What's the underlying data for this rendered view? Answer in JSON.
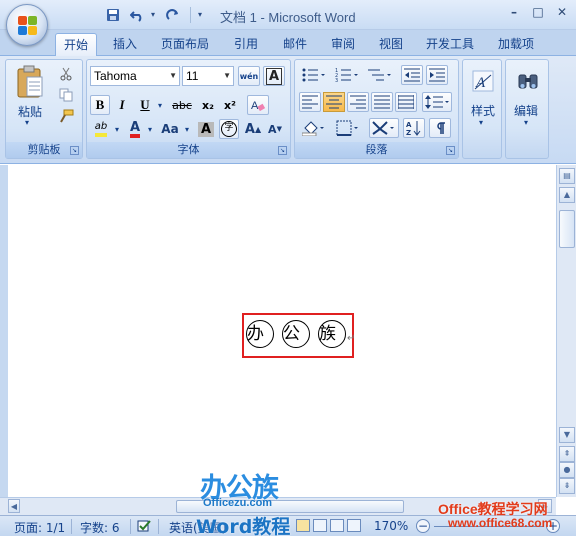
{
  "window": {
    "title": "文档 1 - Microsoft Word",
    "minimize": "–",
    "maximize": "□",
    "close": "✕"
  },
  "qat": {
    "save_icon": "floppy-disk",
    "undo_icon": "undo-arrow",
    "redo_icon": "redo-arrow",
    "customize": "▾"
  },
  "tabs": [
    "开始",
    "插入",
    "页面布局",
    "引用",
    "邮件",
    "审阅",
    "视图",
    "开发工具",
    "加载项"
  ],
  "ribbon": {
    "clipboard": {
      "label": "剪贴板",
      "paste": "粘贴"
    },
    "font": {
      "label": "字体",
      "font_name": "Tahoma",
      "font_size": "11",
      "wen_button": "wén",
      "bold": "B",
      "italic": "I",
      "underline": "U",
      "strike": "abc",
      "subscript": "x₂",
      "superscript": "x²",
      "clear_format": "A",
      "highlight": "ab",
      "font_color": "A",
      "change_case": "Aa",
      "char_shading": "A",
      "enclose_char": "字",
      "grow_font": "A",
      "shrink_font": "A"
    },
    "paragraph": {
      "label": "段落"
    },
    "styles": {
      "label": "样式"
    },
    "editing": {
      "label": "编辑"
    }
  },
  "document": {
    "chars": [
      "办",
      "公",
      "族"
    ],
    "para_mark": "↵"
  },
  "status": {
    "page": "页面: 1/1",
    "words": "字数: 6",
    "language": "英语(美国)",
    "zoom": "170%",
    "zoom_out": "−",
    "zoom_in": "+"
  },
  "watermark": {
    "logo": "办公族",
    "url": "Officezu.com",
    "word": "Word教程",
    "site": "Office教程学习网",
    "site_url": "www.office68.com"
  },
  "colors": {
    "highlight_yellow": "#f5e838",
    "font_red": "#e02020",
    "accent_orange": "#f7b94b"
  }
}
